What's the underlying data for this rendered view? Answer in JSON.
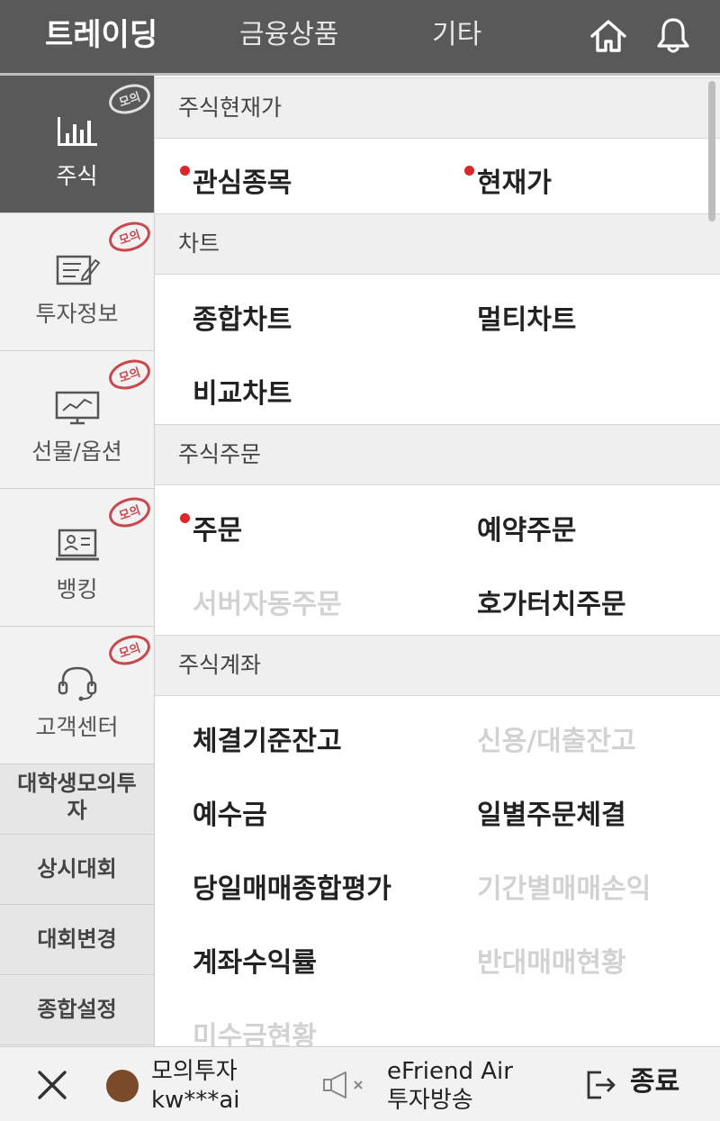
{
  "header": {
    "tabs": [
      "트레이딩",
      "금융상품",
      "기타"
    ],
    "icons": [
      "home-icon",
      "bell-icon"
    ]
  },
  "sidebar": {
    "items": [
      {
        "label": "주식",
        "icon": "bar-chart-icon",
        "stamp": "모의",
        "active": true
      },
      {
        "label": "투자정보",
        "icon": "document-edit-icon",
        "stamp": "모의",
        "active": false
      },
      {
        "label": "선물/옵션",
        "icon": "monitor-chart-icon",
        "stamp": "모의",
        "active": false
      },
      {
        "label": "뱅킹",
        "icon": "laptop-profile-icon",
        "stamp": "모의",
        "active": false
      },
      {
        "label": "고객센터",
        "icon": "headset-icon",
        "stamp": "모의",
        "active": false
      }
    ],
    "extra": [
      {
        "line1": "대학생모의투",
        "line2": "자"
      },
      {
        "line1": "상시대회",
        "line2": ""
      },
      {
        "line1": "대회변경",
        "line2": ""
      },
      {
        "line1": "종합설정",
        "line2": ""
      }
    ]
  },
  "sections": [
    {
      "title": "주식현재가",
      "items": [
        {
          "label": "관심종목",
          "dot": true,
          "disabled": false
        },
        {
          "label": "현재가",
          "dot": true,
          "disabled": false
        }
      ]
    },
    {
      "title": "차트",
      "items": [
        {
          "label": "종합차트",
          "dot": false,
          "disabled": false
        },
        {
          "label": "멀티차트",
          "dot": false,
          "disabled": false
        },
        {
          "label": "비교차트",
          "dot": false,
          "disabled": false
        }
      ]
    },
    {
      "title": "주식주문",
      "items": [
        {
          "label": "주문",
          "dot": true,
          "disabled": false
        },
        {
          "label": "예약주문",
          "dot": false,
          "disabled": false
        },
        {
          "label": "서버자동주문",
          "dot": false,
          "disabled": true
        },
        {
          "label": "호가터치주문",
          "dot": false,
          "disabled": false
        }
      ]
    },
    {
      "title": "주식계좌",
      "items": [
        {
          "label": "체결기준잔고",
          "dot": false,
          "disabled": false
        },
        {
          "label": "신용/대출잔고",
          "dot": false,
          "disabled": true
        },
        {
          "label": "예수금",
          "dot": false,
          "disabled": false
        },
        {
          "label": "일별주문체결",
          "dot": false,
          "disabled": false
        },
        {
          "label": "당일매매종합평가",
          "dot": false,
          "disabled": false
        },
        {
          "label": "기간별매매손익",
          "dot": false,
          "disabled": true
        },
        {
          "label": "계좌수익률",
          "dot": false,
          "disabled": false
        },
        {
          "label": "반대매매현황",
          "dot": false,
          "disabled": true
        },
        {
          "label": "미수금현황",
          "dot": false,
          "disabled": true
        }
      ]
    }
  ],
  "footer": {
    "account_type": "모의투자",
    "user_id": "kw***ai",
    "broadcast_line1": "eFriend Air",
    "broadcast_line2": "투자방송",
    "exit_label": "종료"
  },
  "colors": {
    "header_bg": "#595959",
    "active_sidebar_bg": "#595959",
    "badge_dot": "#d8282b",
    "stamp": "#c9484e",
    "avatar": "#7a4a2b"
  }
}
